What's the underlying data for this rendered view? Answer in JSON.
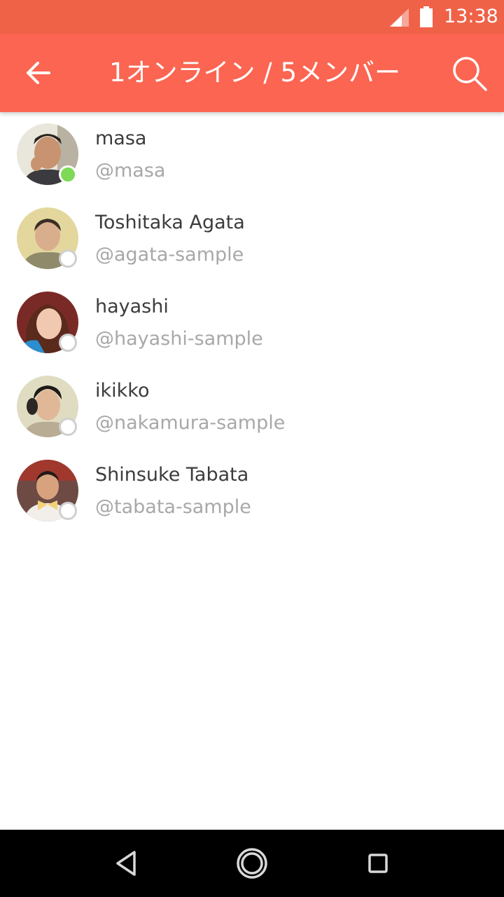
{
  "status_bar": {
    "time": "13:38",
    "icons": [
      "cell-signal-icon",
      "battery-icon"
    ]
  },
  "app_bar": {
    "title": "1オンライン / 5メンバー",
    "back_icon": "arrow-left-icon",
    "search_icon": "search-icon"
  },
  "colors": {
    "status_bar": "#ef6248",
    "app_bar": "#fb6551",
    "online": "#7ed957",
    "offline_ring": "#cfcfcf",
    "name_text": "#3c3c3c",
    "handle_text": "#a8a8a8"
  },
  "members": [
    {
      "name": "masa",
      "handle": "@masa",
      "status": "online"
    },
    {
      "name": "Toshitaka Agata",
      "handle": "@agata-sample",
      "status": "offline"
    },
    {
      "name": "hayashi",
      "handle": "@hayashi-sample",
      "status": "offline"
    },
    {
      "name": "ikikko",
      "handle": "@nakamura-sample",
      "status": "offline"
    },
    {
      "name": "Shinsuke Tabata",
      "handle": "@tabata-sample",
      "status": "offline"
    }
  ],
  "nav_bar": {
    "icons": [
      "back-triangle-icon",
      "home-circle-icon",
      "recents-square-icon"
    ]
  }
}
